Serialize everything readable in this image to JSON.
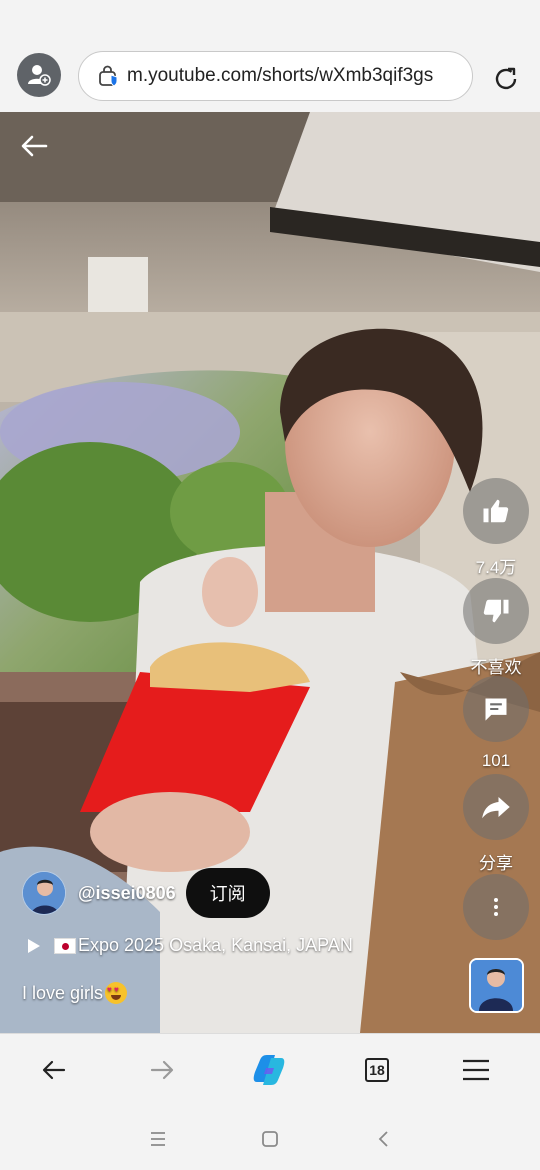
{
  "browser": {
    "url": "m.youtube.com/shorts/wXmb3qif3gs",
    "tab_count": "18"
  },
  "short": {
    "actions": {
      "like_count": "7.4万",
      "dislike_label": "不喜欢",
      "comment_count": "101",
      "share_label": "分享"
    },
    "channel_handle": "@issei0806",
    "subscribe_label": "订阅",
    "location": "Expo 2025 Osaka, Kansai, JAPAN",
    "caption": "I love girls"
  },
  "icons": {
    "profile": "profile-add-icon",
    "lock": "site-security-icon",
    "reload": "reload-icon",
    "back": "back-arrow-icon",
    "like": "thumbs-up-icon",
    "dislike": "thumbs-down-icon",
    "comment": "comment-icon",
    "share": "share-icon",
    "more": "more-vertical-icon",
    "copilot": "copilot-icon",
    "menu": "hamburger-menu-icon"
  },
  "colors": {
    "browser_chrome": "#f3f3f3",
    "subscribe_bg": "#0f0f0f",
    "action_circle": "#6e6e6e",
    "copilot_blue": "#1d8fe8"
  }
}
